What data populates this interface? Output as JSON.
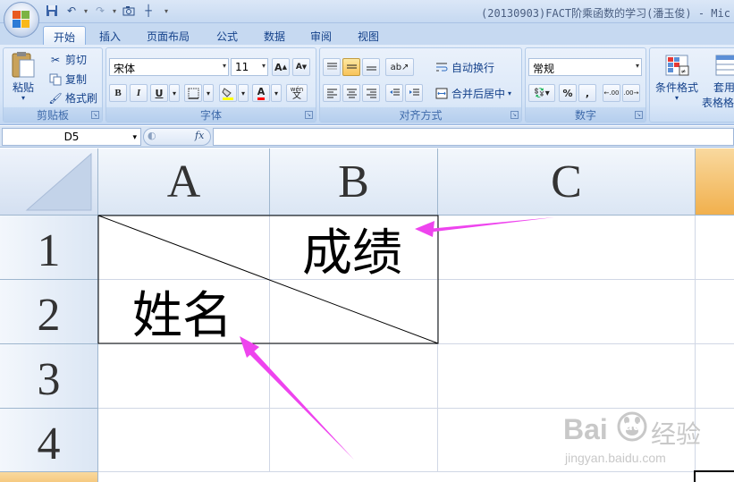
{
  "titlebar": {
    "title": "(20130903)FACT阶乘函数的学习(潘玉俊) - Mic"
  },
  "tabs": [
    {
      "label": "开始",
      "active": true
    },
    {
      "label": "插入"
    },
    {
      "label": "页面布局"
    },
    {
      "label": "公式"
    },
    {
      "label": "数据"
    },
    {
      "label": "审阅"
    },
    {
      "label": "视图"
    }
  ],
  "ribbon": {
    "clipboard": {
      "label": "剪贴板",
      "paste": "粘贴",
      "cut": "剪切",
      "copy": "复制",
      "format_painter": "格式刷"
    },
    "font": {
      "label": "字体",
      "font_name": "宋体",
      "font_size": "11",
      "bold": "B",
      "italic": "I",
      "underline": "U",
      "grow": "A",
      "shrink": "A",
      "font_color_letter": "A",
      "phonetic": "wén"
    },
    "alignment": {
      "label": "对齐方式",
      "wrap_text": "自动换行",
      "merge_center": "合并后居中"
    },
    "number": {
      "label": "数字",
      "format": "常规",
      "percent": "%",
      "comma": ",",
      "inc_decimal": ".00",
      "dec_decimal": ".00"
    },
    "styles": {
      "conditional_format": "条件格式",
      "table_format_line1": "套用",
      "table_format_line2": "表格格"
    }
  },
  "formula_bar": {
    "name_box": "D5",
    "fx": "fx",
    "content": ""
  },
  "sheet": {
    "columns": [
      "A",
      "B",
      "C"
    ],
    "rows": [
      "1",
      "2",
      "3",
      "4"
    ],
    "cells": {
      "B1": "成绩",
      "A2": "姓名"
    },
    "selected_cell": "D5"
  },
  "watermark": {
    "logo_text": "Bai",
    "logo_text2": "du",
    "suffix": "经验",
    "url": "jingyan.baidu.com"
  },
  "colors": {
    "annotation_arrow": "#ee44ee",
    "selected_header": "#f1b04d"
  }
}
